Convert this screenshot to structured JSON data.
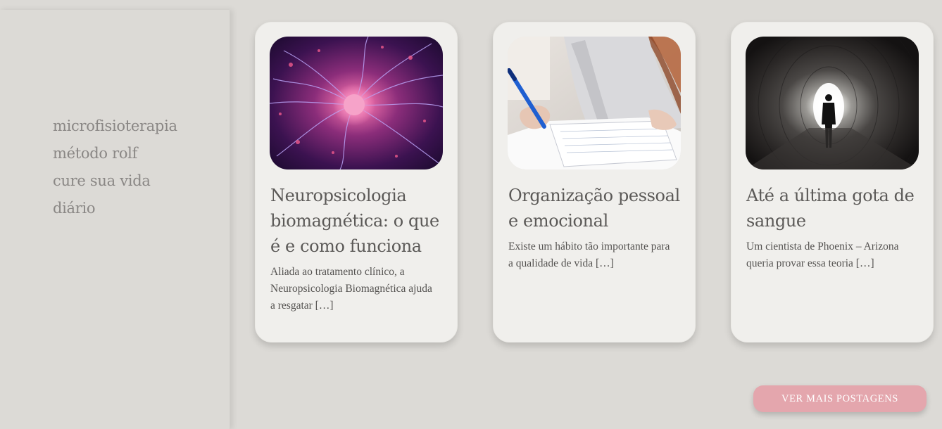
{
  "sidebar": {
    "menu": [
      {
        "label": "microfisioterapia"
      },
      {
        "label": "método rolf"
      },
      {
        "label": "cure sua vida"
      },
      {
        "label": "diário"
      }
    ]
  },
  "posts": [
    {
      "title": "Neuropsicologia biomagnética: o que é e como funciona",
      "excerpt": "Aliada ao tratamento clínico, a Neuropsicologia Biomagnética ajuda a resgatar […]",
      "image_icon": "neuron-plasma-image"
    },
    {
      "title": "Organização pessoal e emocional",
      "excerpt": "Existe um hábito tão importante para a qualidade de vida […]",
      "image_icon": "writing-notebook-image"
    },
    {
      "title": "Até a última gota de sangue",
      "excerpt": "Um cientista de Phoenix – Arizona queria provar essa teoria […]",
      "image_icon": "tunnel-silhouette-image"
    }
  ],
  "more_button": {
    "label": "VER MAIS POSTAGENS"
  },
  "colors": {
    "background": "#dcdad6",
    "card": "#f0efec",
    "accent": "#e4a6ad",
    "menu_text": "#8a8785"
  }
}
